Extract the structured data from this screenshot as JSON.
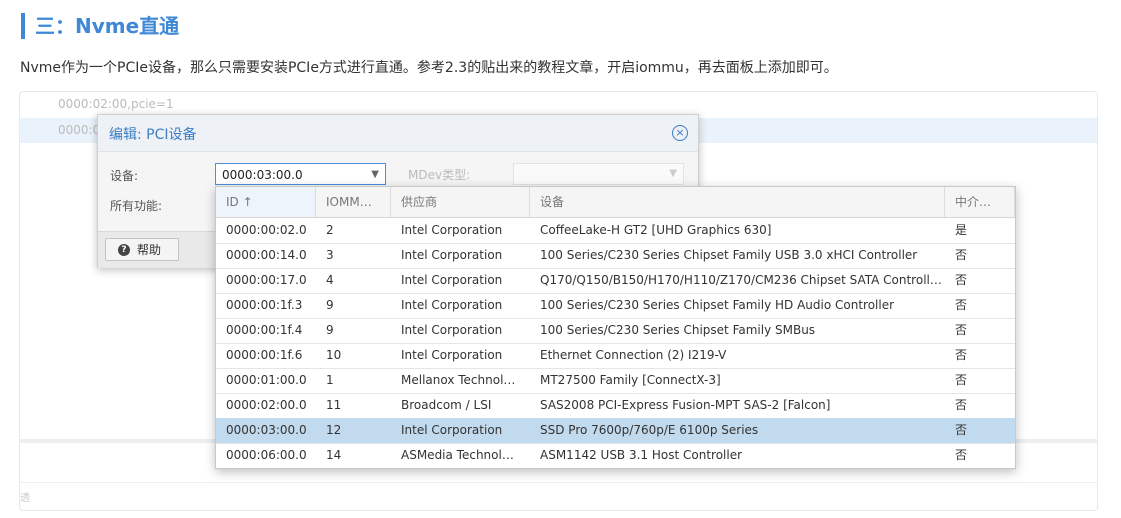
{
  "article": {
    "heading": "三：Nvme直通",
    "paragraph": "Nvme作为一个PCIe设备，那么只需要安装PCIe方式进行直通。参考2.3的贴出来的教程文章，开启iommu，再去面板上添加即可。"
  },
  "background": {
    "row1": "0000:02:00,pcie=1",
    "row2": "0000:0",
    "footer": "透"
  },
  "dialog": {
    "title": "编辑: PCI设备",
    "device_label": "设备:",
    "device_value": "0000:03:00.0",
    "mdev_label": "MDev类型:",
    "all_functions_label": "所有功能:",
    "help_label": "帮助"
  },
  "table": {
    "columns": [
      "ID ↑",
      "IOMM…",
      "供应商",
      "设备",
      "中介…"
    ],
    "rows": [
      {
        "id": "0000:00:02.0",
        "iommu": "2",
        "vendor": "Intel Corporation",
        "device": "CoffeeLake-H GT2 [UHD Graphics 630]",
        "mediated": "是"
      },
      {
        "id": "0000:00:14.0",
        "iommu": "3",
        "vendor": "Intel Corporation",
        "device": "100 Series/C230 Series Chipset Family USB 3.0 xHCI Controller",
        "mediated": "否"
      },
      {
        "id": "0000:00:17.0",
        "iommu": "4",
        "vendor": "Intel Corporation",
        "device": "Q170/Q150/B150/H170/H110/Z170/CM236 Chipset SATA Controll…",
        "mediated": "否"
      },
      {
        "id": "0000:00:1f.3",
        "iommu": "9",
        "vendor": "Intel Corporation",
        "device": "100 Series/C230 Series Chipset Family HD Audio Controller",
        "mediated": "否"
      },
      {
        "id": "0000:00:1f.4",
        "iommu": "9",
        "vendor": "Intel Corporation",
        "device": "100 Series/C230 Series Chipset Family SMBus",
        "mediated": "否"
      },
      {
        "id": "0000:00:1f.6",
        "iommu": "10",
        "vendor": "Intel Corporation",
        "device": "Ethernet Connection (2) I219-V",
        "mediated": "否"
      },
      {
        "id": "0000:01:00.0",
        "iommu": "1",
        "vendor": "Mellanox Technol…",
        "device": "MT27500 Family [ConnectX-3]",
        "mediated": "否"
      },
      {
        "id": "0000:02:00.0",
        "iommu": "11",
        "vendor": "Broadcom / LSI",
        "device": "SAS2008 PCI-Express Fusion-MPT SAS-2 [Falcon]",
        "mediated": "否"
      },
      {
        "id": "0000:03:00.0",
        "iommu": "12",
        "vendor": "Intel Corporation",
        "device": "SSD Pro 7600p/760p/E 6100p Series",
        "mediated": "否"
      },
      {
        "id": "0000:06:00.0",
        "iommu": "14",
        "vendor": "ASMedia Technol…",
        "device": "ASM1142 USB 3.1 Host Controller",
        "mediated": "否"
      }
    ],
    "selected_id": "0000:03:00.0"
  },
  "colors": {
    "accent": "#3f88d6",
    "selected_row": "#c2daee"
  }
}
